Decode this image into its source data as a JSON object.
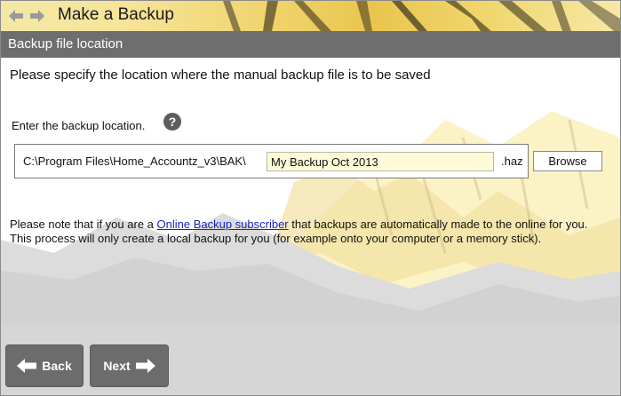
{
  "window": {
    "title": "Make a Backup",
    "back_icon": "arrow-left-icon",
    "forward_icon": "arrow-right-icon"
  },
  "section": {
    "title": "Backup file location"
  },
  "main": {
    "instruction": "Please specify the location where the manual backup file is to be saved",
    "location_label": "Enter the backup location.",
    "help_icon": "question-mark-icon",
    "help_glyph": "?",
    "path_prefix": "C:\\Program Files\\Home_Accountz_v3\\BAK\\",
    "filename_value": "My Backup Oct 2013",
    "extension": ".haz",
    "browse_label": "Browse",
    "note_before_link": "Please note that if you are a ",
    "note_link": "Online Backup subscriber",
    "note_after_link": " that backups are automatically made to the online for you. This process will only create a local backup for you (for example onto your computer or a memory stick)."
  },
  "footer": {
    "back_label": "Back",
    "next_label": "Next"
  },
  "colors": {
    "title_bar": "#efd36a",
    "section_header": "#6e6e6e",
    "button": "#6c6c6c",
    "input_fill": "#fdfad8",
    "link": "#1a22c4"
  }
}
